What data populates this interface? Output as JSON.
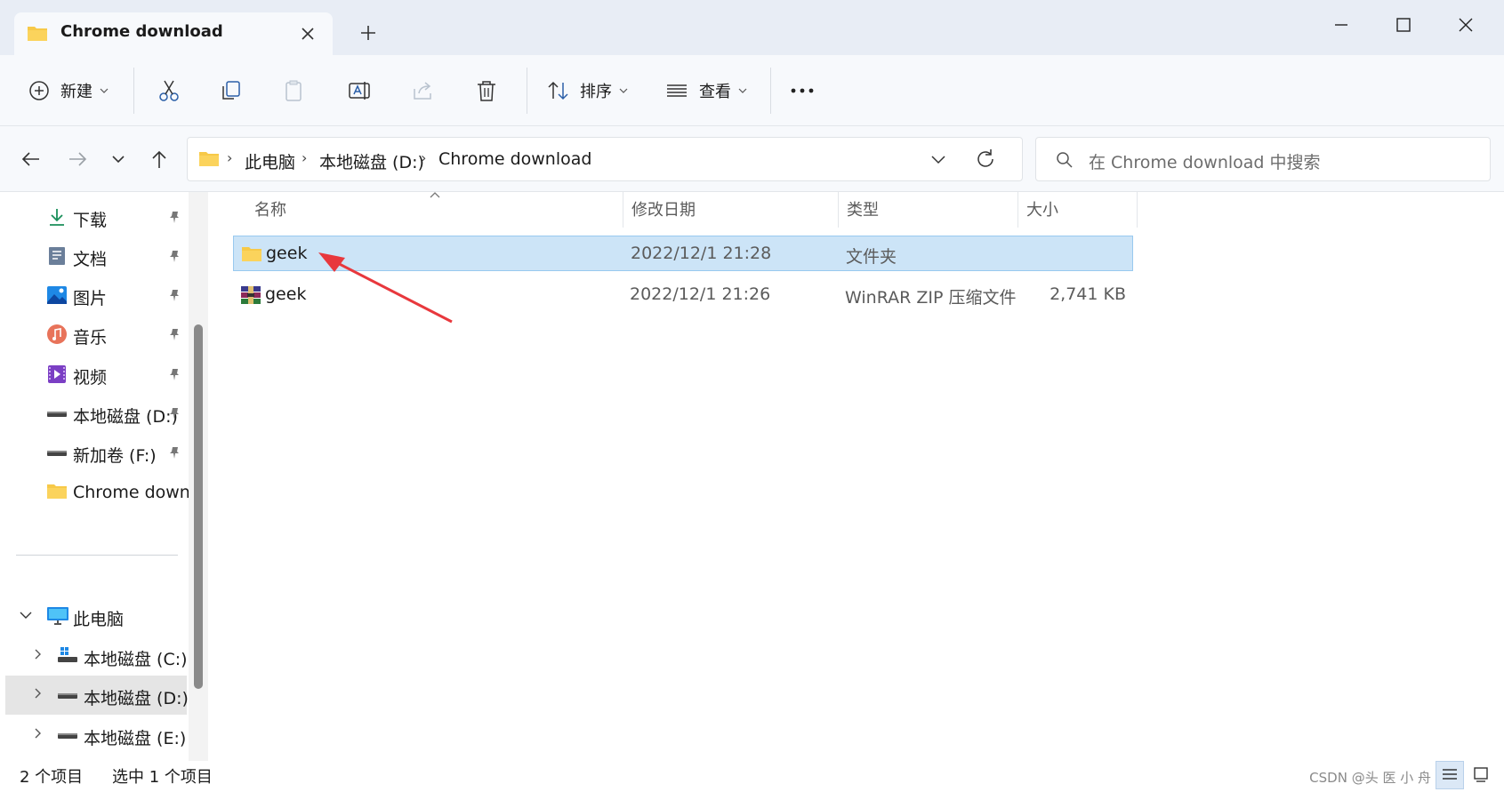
{
  "window": {
    "tab_title": "Chrome download",
    "new_tab_symbol": "+"
  },
  "toolbar": {
    "new_label": "新建",
    "sort_label": "排序",
    "view_label": "查看",
    "icons": [
      "plus-circle-icon",
      "cut-icon",
      "copy-icon",
      "paste-icon",
      "rename-icon",
      "share-icon",
      "delete-icon",
      "sort-icon",
      "view-icon",
      "more-icon"
    ]
  },
  "address": {
    "crumbs": [
      "此电脑",
      "本地磁盘 (D:)",
      "Chrome download"
    ],
    "separator": "›",
    "search_placeholder": "在 Chrome download 中搜索"
  },
  "sidebar": {
    "quick_access": [
      {
        "label": "下载",
        "icon": "download-icon"
      },
      {
        "label": "文档",
        "icon": "document-icon"
      },
      {
        "label": "图片",
        "icon": "picture-icon"
      },
      {
        "label": "音乐",
        "icon": "music-icon"
      },
      {
        "label": "视频",
        "icon": "video-icon"
      },
      {
        "label": "本地磁盘 (D:)",
        "icon": "drive-icon"
      },
      {
        "label": "新加卷 (F:)",
        "icon": "drive-icon"
      },
      {
        "label": "Chrome download",
        "icon": "folder-icon"
      }
    ],
    "this_pc": "此电脑",
    "drives": [
      {
        "label": "本地磁盘 (C:)",
        "icon": "windows-drive-icon"
      },
      {
        "label": "本地磁盘 (D:)",
        "icon": "drive-icon",
        "selected": true
      },
      {
        "label": "本地磁盘 (E:)",
        "icon": "drive-icon"
      }
    ]
  },
  "file_list": {
    "columns": [
      "名称",
      "修改日期",
      "类型",
      "大小"
    ],
    "sorted_column": "名称",
    "rows": [
      {
        "name": "geek",
        "modified": "2022/12/1 21:28",
        "type": "文件夹",
        "size": "",
        "icon": "folder-icon",
        "selected": true
      },
      {
        "name": "geek",
        "modified": "2022/12/1 21:26",
        "type": "WinRAR ZIP 压缩文件",
        "size": "2,741 KB",
        "icon": "winrar-archive-icon",
        "selected": false
      }
    ]
  },
  "annotation": {
    "type": "red-arrow",
    "color": "#e8383d",
    "points_to": "geek folder row"
  },
  "status": {
    "item_count": "2 个项目",
    "selection": "选中 1 个项目",
    "watermark": "CSDN @头 医 小 舟"
  },
  "colors": {
    "accent": "#0067c0",
    "selection_bg": "#cce4f7",
    "folder_yellow": "#f7c948",
    "titlebar_bg": "#e8edf5"
  }
}
